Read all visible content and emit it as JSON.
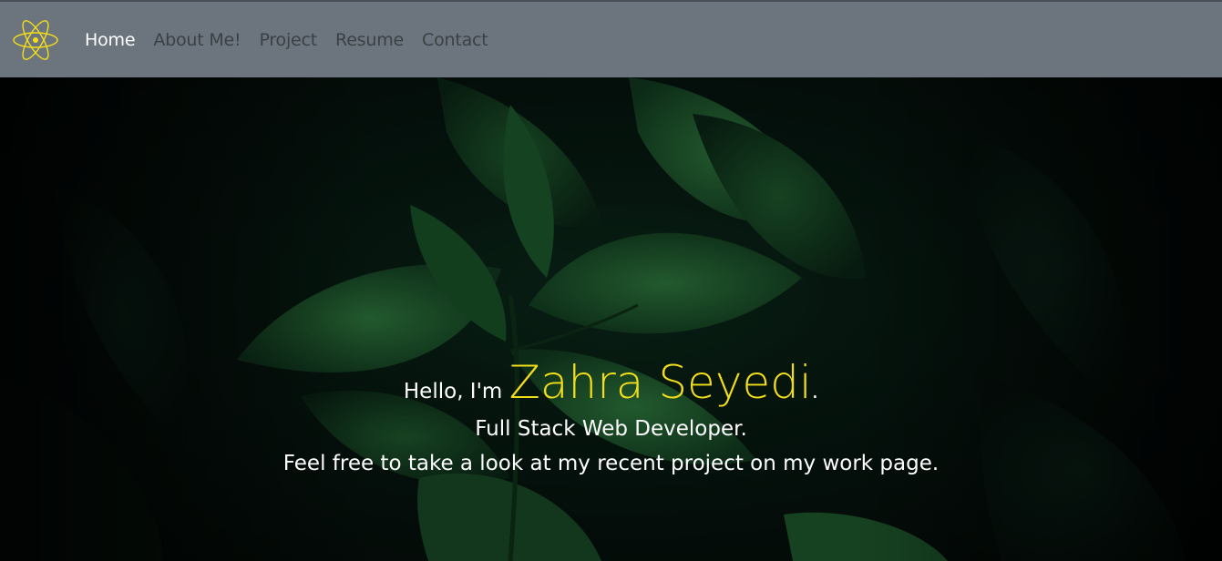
{
  "navbar": {
    "logo_icon": "atom-icon",
    "logo_color": "#f2dd1b",
    "background": "#6c757d",
    "items": [
      {
        "label": "Home",
        "active": true
      },
      {
        "label": "About Me!",
        "active": false
      },
      {
        "label": "Project",
        "active": false
      },
      {
        "label": "Resume",
        "active": false
      },
      {
        "label": "Contact",
        "active": false
      }
    ]
  },
  "hero": {
    "greeting": "Hello, I'm",
    "name": "Zahra Seyedi",
    "name_suffix": ".",
    "title": "Full Stack Web Developer.",
    "tagline": "Feel free to take a look at my recent project on my work page.",
    "background_image": "green-leaves-photo",
    "accent_color": "#f2dd1b"
  }
}
